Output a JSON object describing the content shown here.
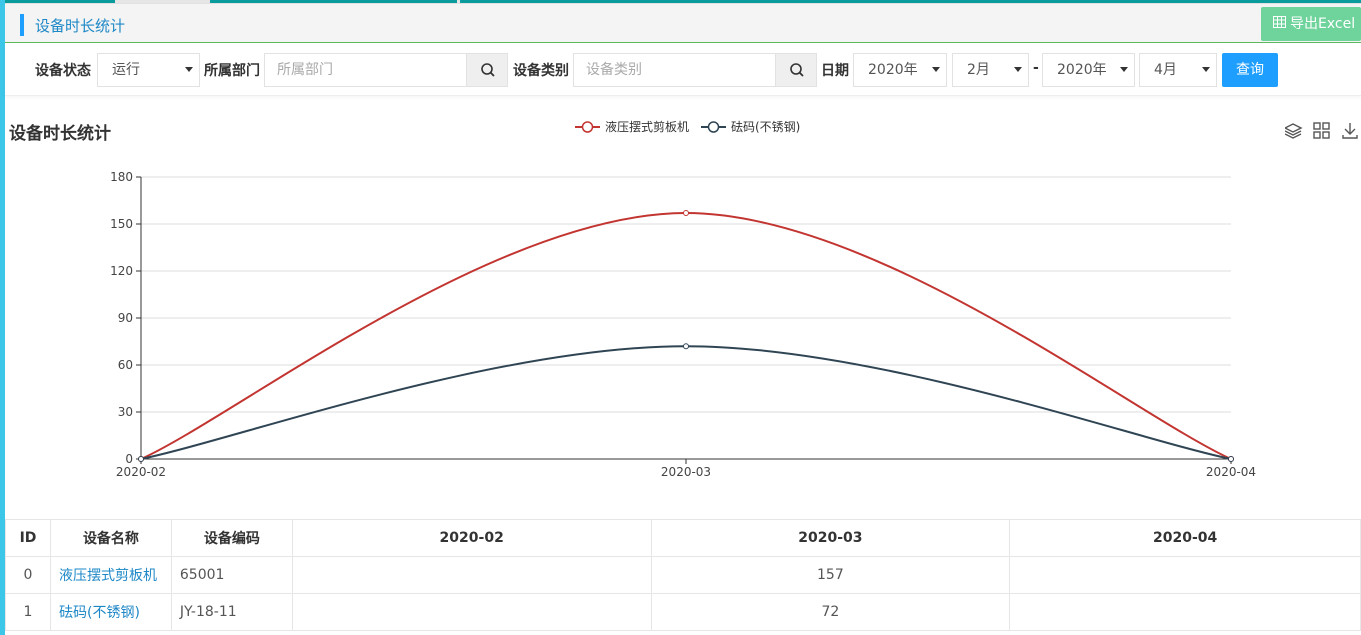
{
  "header": {
    "title": "设备时长统计",
    "export_label": "导出Excel"
  },
  "filters": {
    "status_label": "设备状态",
    "status_value": "运行",
    "dept_label": "所属部门",
    "dept_placeholder": "所属部门",
    "category_label": "设备类别",
    "category_placeholder": "设备类别",
    "date_label": "日期",
    "start_year": "2020年",
    "start_month": "2月",
    "separator": "-",
    "end_year": "2020年",
    "end_month": "4月",
    "query_label": "查询"
  },
  "chart_title": "设备时长统计",
  "chart_data": {
    "type": "line",
    "categories": [
      "2020-02",
      "2020-03",
      "2020-04"
    ],
    "series": [
      {
        "name": "液压摆式剪板机",
        "values": [
          0,
          157,
          0
        ],
        "color": "#c23531"
      },
      {
        "name": "砝码(不锈钢)",
        "values": [
          0,
          72,
          0
        ],
        "color": "#2f4554"
      }
    ],
    "ylim": [
      0,
      180
    ],
    "yticks": [
      0,
      30,
      60,
      90,
      120,
      150,
      180
    ],
    "smooth": true,
    "grid": true,
    "legend": "top-center"
  },
  "table": {
    "headers": [
      "ID",
      "设备名称",
      "设备编码",
      "2020-02",
      "2020-03",
      "2020-04"
    ],
    "rows": [
      [
        "0",
        "液压摆式剪板机",
        "65001",
        "",
        "157",
        ""
      ],
      [
        "1",
        "砝码(不锈钢)",
        "JY-18-11",
        "",
        "72",
        ""
      ]
    ]
  }
}
